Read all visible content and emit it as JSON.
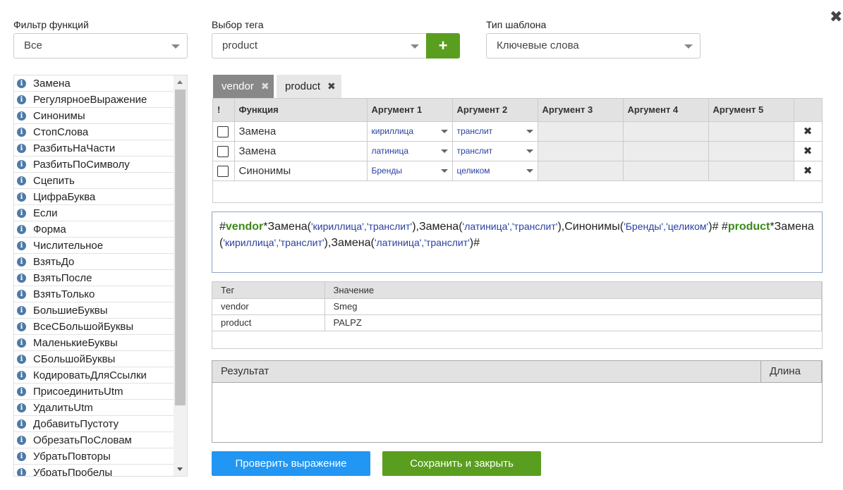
{
  "filter": {
    "label": "Фильтр функций",
    "value": "Все"
  },
  "tag_select": {
    "label": "Выбор тега",
    "value": "product",
    "add_label": "+"
  },
  "template_type": {
    "label": "Тип шаблона",
    "value": "Ключевые слова"
  },
  "close_label": "✖",
  "functions": [
    "Замена",
    "РегулярноеВыражение",
    "Синонимы",
    "СтопСлова",
    "РазбитьНаЧасти",
    "РазбитьПоСимволу",
    "Сцепить",
    "ЦифраБуква",
    "Если",
    "Форма",
    "Числительное",
    "ВзятьДо",
    "ВзятьПосле",
    "ВзятьТолько",
    "БольшиеБуквы",
    "ВсеСБольшойБуквы",
    "МаленькиеБуквы",
    "СБольшойБуквы",
    "КодироватьДляСсылки",
    "ПрисоединитьUtm",
    "УдалитьUtm",
    "ДобавитьПустоту",
    "ОбрезатьПоСловам",
    "УбратьПовторы",
    "УбратьПробелы"
  ],
  "info_icon": "i",
  "tabs": [
    {
      "label": "vendor",
      "active": true
    },
    {
      "label": "product",
      "active": false
    }
  ],
  "tab_close": "✖",
  "grid": {
    "headers": [
      "!",
      "Функция",
      "Аргумент 1",
      "Аргумент 2",
      "Аргумент 3",
      "Аргумент 4",
      "Аргумент 5",
      ""
    ],
    "rows": [
      {
        "func": "Замена",
        "arg1": "кириллица",
        "arg2": "транслит"
      },
      {
        "func": "Замена",
        "arg1": "латиница",
        "arg2": "транслит"
      },
      {
        "func": "Синонимы",
        "arg1": "Бренды",
        "arg2": "целиком"
      }
    ],
    "delete_label": "✖"
  },
  "expression": {
    "segments": [
      {
        "t": "#",
        "c": "plain"
      },
      {
        "t": "vendor",
        "c": "tag"
      },
      {
        "t": "*Замена(",
        "c": "plain"
      },
      {
        "t": "'кириллица','транслит'",
        "c": "arg"
      },
      {
        "t": "),Замена(",
        "c": "plain"
      },
      {
        "t": "'латиница','транслит'",
        "c": "arg"
      },
      {
        "t": "),Синонимы(",
        "c": "plain"
      },
      {
        "t": "'Бренды','целиком'",
        "c": "arg"
      },
      {
        "t": ")# #",
        "c": "plain"
      },
      {
        "t": "product",
        "c": "tag"
      },
      {
        "t": "*Замена(",
        "c": "plain"
      },
      {
        "t": "'кириллица','транслит'",
        "c": "arg"
      },
      {
        "t": "),Замена(",
        "c": "plain"
      },
      {
        "t": "'латиница','транслит'",
        "c": "arg"
      },
      {
        "t": ")#",
        "c": "plain"
      }
    ]
  },
  "tag_table": {
    "headers": [
      "Тег",
      "Значение"
    ],
    "rows": [
      {
        "tag": "vendor",
        "value": "Smeg"
      },
      {
        "tag": "product",
        "value": "PALPZ"
      }
    ]
  },
  "result_table": {
    "headers": [
      "Результат",
      "Длина"
    ]
  },
  "buttons": {
    "check": "Проверить выражение",
    "save": "Сохранить и закрыть"
  },
  "colors": {
    "green": "#5a9e1f",
    "blue": "#2196f3",
    "tag_green": "#3a8a1b",
    "arg_blue": "#2a3fa0"
  }
}
